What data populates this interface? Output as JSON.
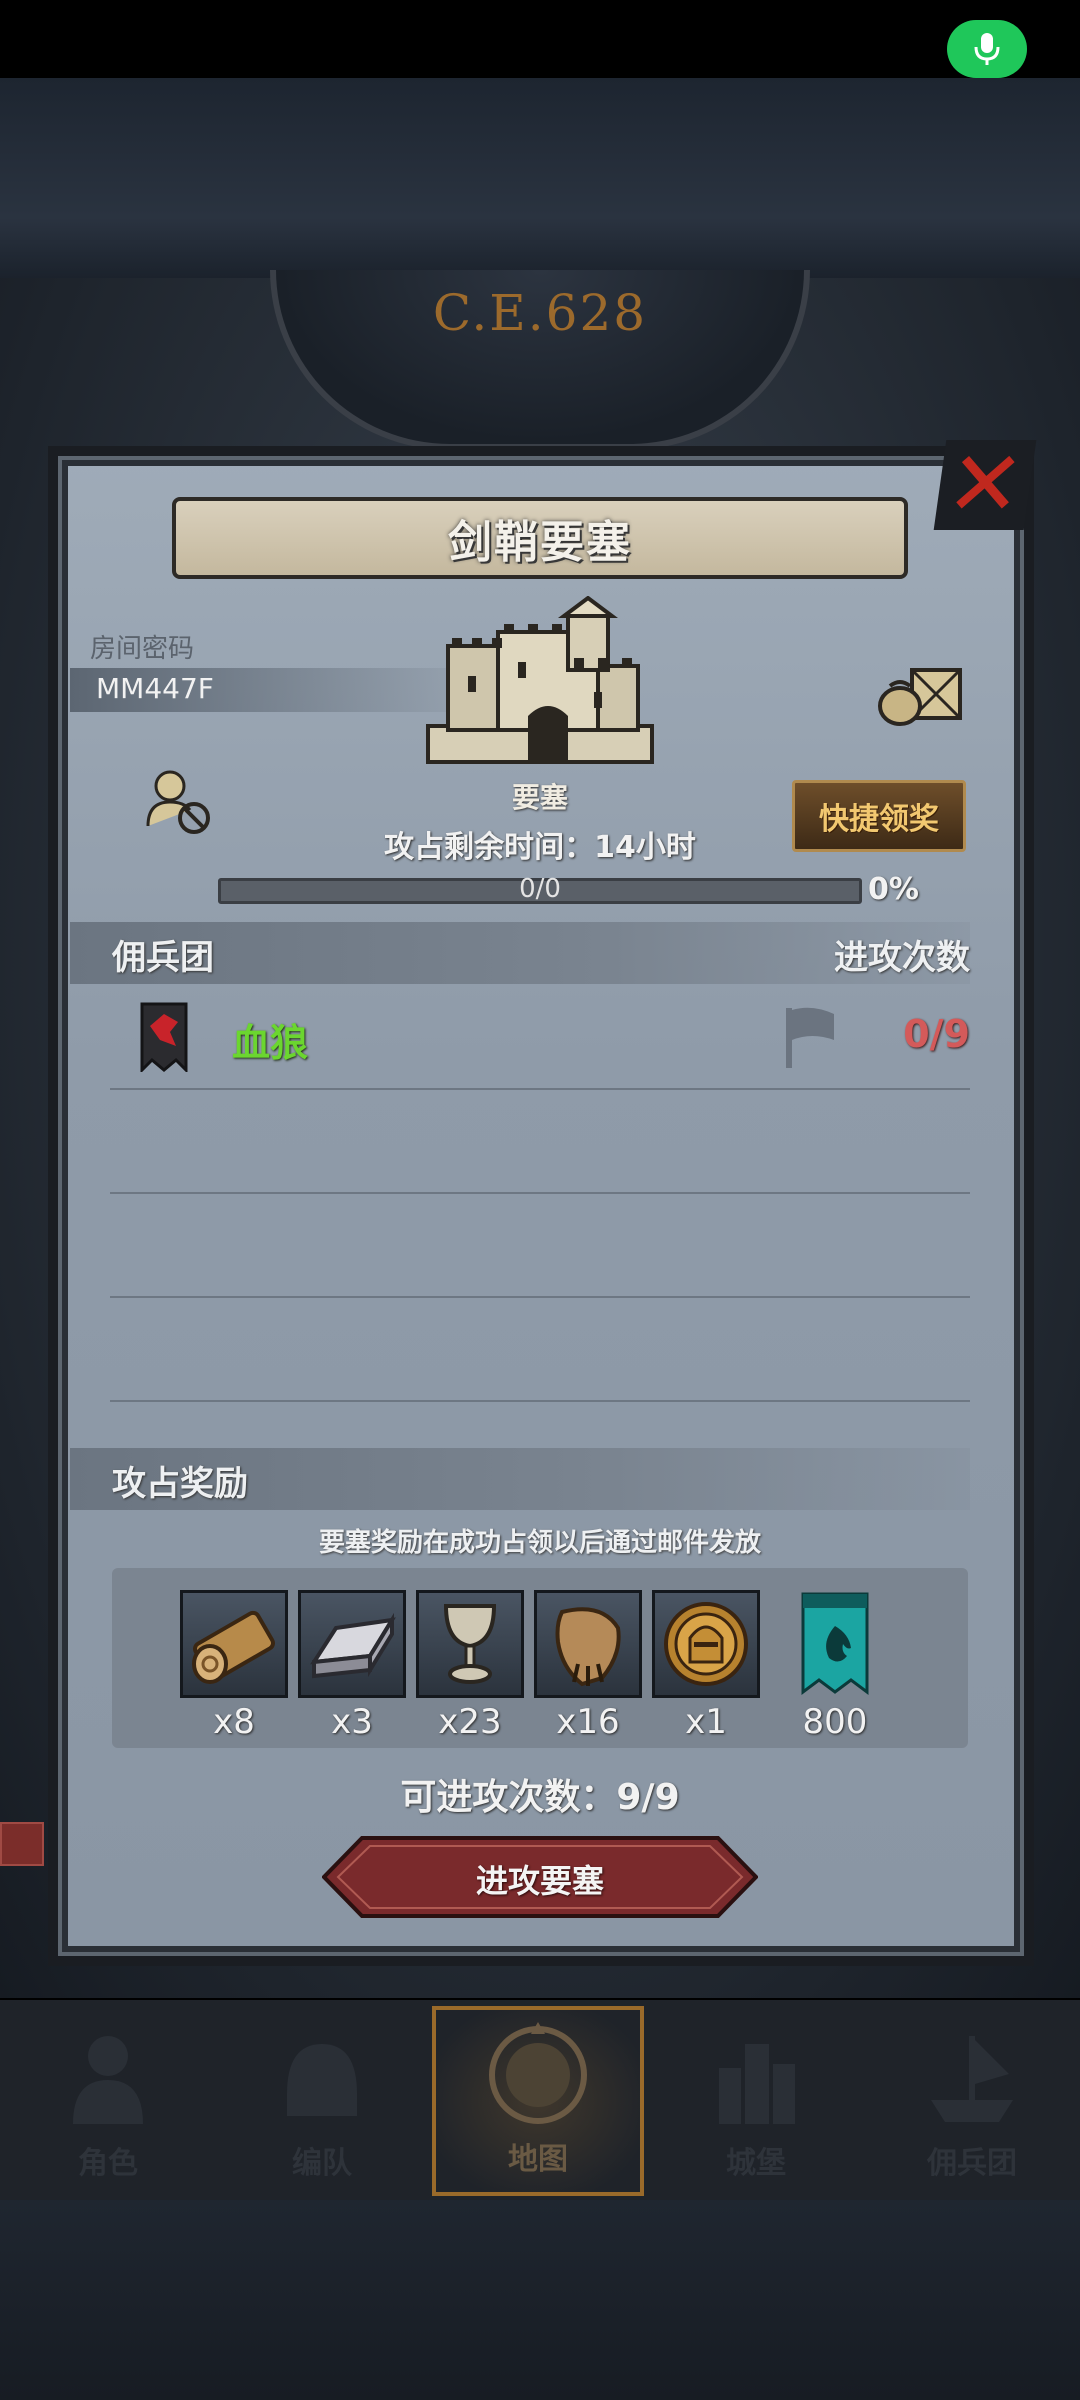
{
  "era": "C.E.628",
  "dialog": {
    "title": "剑鞘要塞",
    "room_label": "房间密码",
    "room_code": "MM447F",
    "building_label": "要塞",
    "quick_claim": "快捷领奖",
    "remaining_time": "攻占剩余时间：14小时",
    "progress": {
      "text": "0/0",
      "percent_label": "0%",
      "fraction": 0.0
    },
    "mercenary_header": "佣兵团",
    "attack_count_header": "进攻次数",
    "mercenaries": [
      {
        "name": "血狼",
        "attacks": "0/9",
        "name_color": "#6bd62f"
      }
    ],
    "reward_header": "攻占奖励",
    "reward_note": "要塞奖励在成功占领以后通过邮件发放",
    "rewards": [
      {
        "icon": "wood-log-icon",
        "qty": "x8"
      },
      {
        "icon": "iron-ingot-icon",
        "qty": "x3"
      },
      {
        "icon": "chalice-icon",
        "qty": "x23"
      },
      {
        "icon": "fur-pelt-icon",
        "qty": "x16"
      },
      {
        "icon": "golden-helmet-icon",
        "qty": "x1"
      },
      {
        "icon": "teal-banner-icon",
        "qty": "800"
      }
    ],
    "attack_remaining": "可进攻次数：9/9",
    "attack_button": "进攻要塞"
  },
  "nav": {
    "items": [
      {
        "label": "角色",
        "icon": "character-knight-icon"
      },
      {
        "label": "编队",
        "icon": "formation-helmet-icon"
      },
      {
        "label": "地图",
        "icon": "map-compass-icon",
        "active": true
      },
      {
        "label": "城堡",
        "icon": "castle-towers-icon"
      },
      {
        "label": "佣兵团",
        "icon": "mercenary-ship-icon"
      }
    ]
  },
  "colors": {
    "accent_gold": "#b08a4e",
    "attack_button_red": "#7a2a2c",
    "close_red": "#c0281e",
    "mic_green": "#1fc75a"
  }
}
